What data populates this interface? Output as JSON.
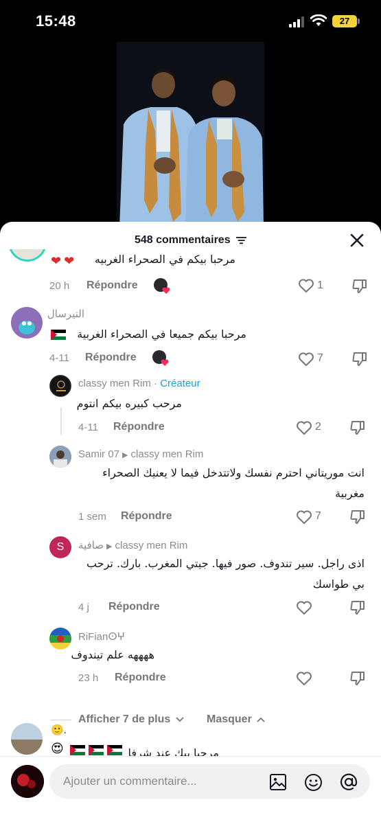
{
  "status": {
    "time": "15:48",
    "battery": "27"
  },
  "header": {
    "count_label": "548 commentaires"
  },
  "comments": [
    {
      "text": "مرحبا بيكم في الصحراء الغربيه",
      "time": "20 h",
      "reply": "Répondre",
      "likes": "1"
    },
    {
      "user": "التيرسال",
      "text": "مرحبا بيكم جميعا في الصحراء الغربية",
      "time": "4-11",
      "reply": "Répondre",
      "likes": "7"
    },
    {
      "user": "classy men Rim",
      "separator": " · ",
      "badge": "Créateur",
      "text": "مرحب كبيره بيكم انتوم",
      "time": "4-11",
      "reply": "Répondre",
      "likes": "2"
    },
    {
      "user": "Samir 07",
      "reply_to": "classy men Rim",
      "text": "انت موريتاني احترم نفسك ولاتتدخل فيما لا يعنيك الصحراء مغربية",
      "time": "1 sem",
      "reply": "Répondre",
      "likes": "7"
    },
    {
      "user": "صافية",
      "avatar_letter": "S",
      "reply_to": "classy men Rim",
      "text": "اذى راجل. سير تندوف. صور فيها. جيتي المغرب. بارك. ترحب بي طواسك",
      "time": "4 j",
      "reply": "Répondre"
    },
    {
      "user": "RiFianⵙⵖ",
      "text": "ههههه علم تيندوف",
      "time": "23 h",
      "reply": "Répondre"
    },
    {
      "user": "🙂.",
      "text": "مرحبا بيك عند شرفا"
    }
  ],
  "replies_toggle": {
    "show_more": "Afficher 7 de plus",
    "hide": "Masquer"
  },
  "input": {
    "placeholder": "Ajouter un commentaire..."
  },
  "colors": {
    "accent": "#1da1c8",
    "text": "#161823",
    "muted": "#8a8b91",
    "heart": "#e0282e",
    "battery": "#f4d33a"
  },
  "icons": [
    "signal-icon",
    "wifi-icon",
    "filter-icon",
    "close-icon",
    "heart-outline-icon",
    "dislike-icon",
    "chevron-down-icon",
    "chevron-up-icon",
    "image-icon",
    "emoji-icon",
    "at-icon"
  ]
}
